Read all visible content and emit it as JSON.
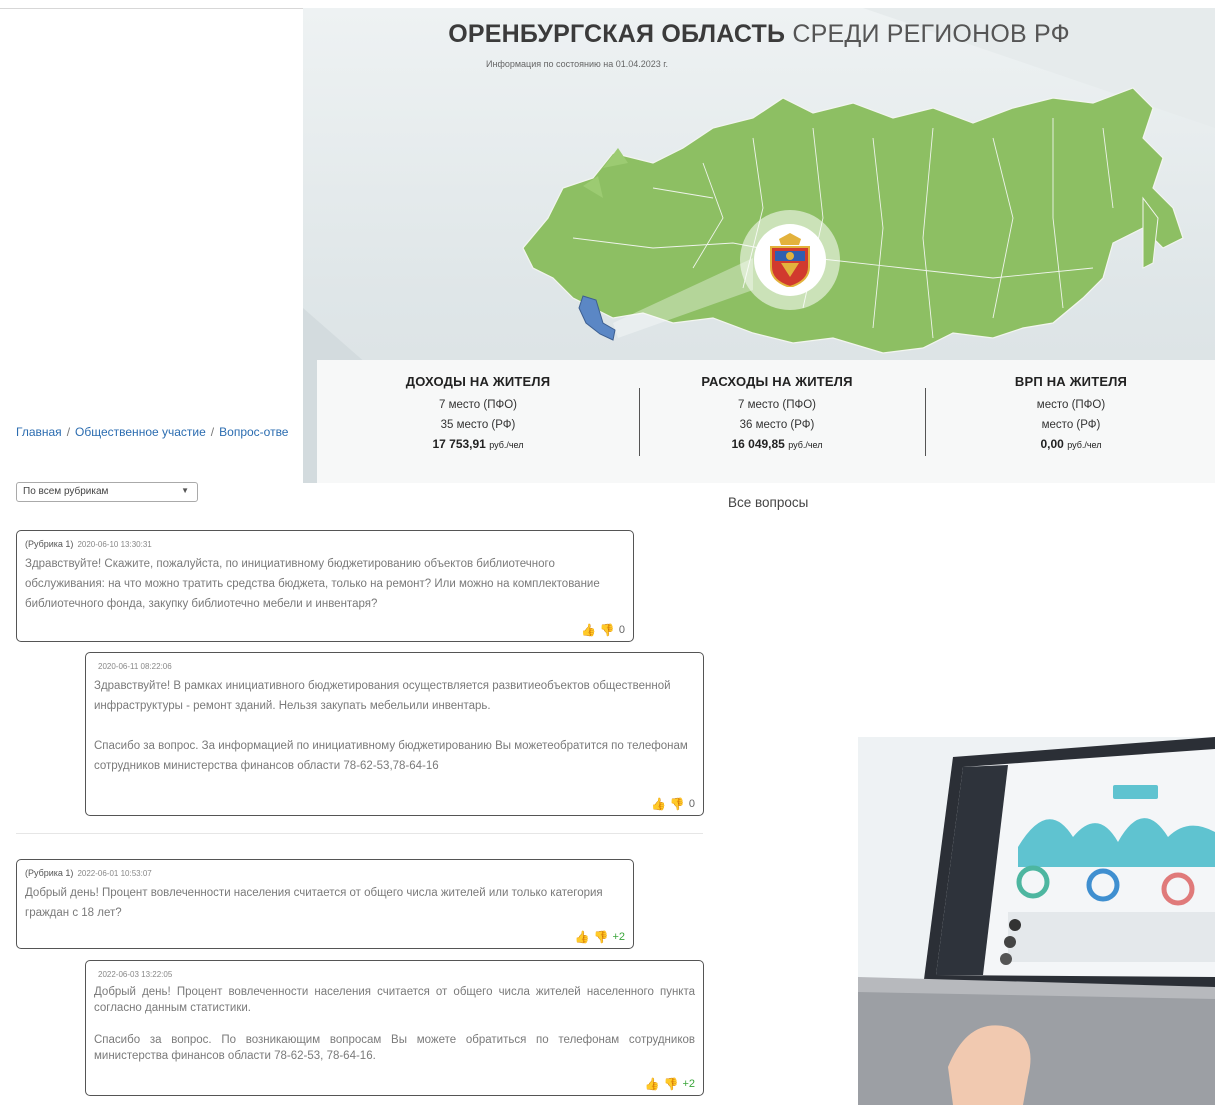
{
  "banner": {
    "title_bold": "ОРЕНБУРГСКАЯ ОБЛАСТЬ",
    "title_rest": "СРЕДИ РЕГИОНОВ РФ",
    "subtitle": "Информация по состоянию на 01.04.2023 г.",
    "stats": [
      {
        "heading": "ДОХОДЫ НА ЖИТЕЛЯ",
        "rank_pfo": "7 место (ПФО)",
        "rank_rf": "35 место (РФ)",
        "value": "17 753,91",
        "unit": "руб./чел"
      },
      {
        "heading": "РАСХОДЫ НА ЖИТЕЛЯ",
        "rank_pfo": "7 место (ПФО)",
        "rank_rf": "36 место (РФ)",
        "value": "16 049,85",
        "unit": "руб./чел"
      },
      {
        "heading": "ВРП НА ЖИТЕЛЯ",
        "rank_pfo": "место (ПФО)",
        "rank_rf": "место (РФ)",
        "value": "0,00",
        "unit": "руб./чел"
      }
    ]
  },
  "breadcrumb": {
    "home": "Главная",
    "section": "Общественное участие",
    "current": "Вопрос-отве",
    "separator": "/"
  },
  "filter": {
    "selected": "По всем рубрикам",
    "arrow": "▼"
  },
  "sidebar": {
    "all_questions": "Все вопросы"
  },
  "threads": [
    {
      "question": {
        "rubric": "(Рубрика 1)",
        "date": "2020-06-10 13:30:31",
        "text": "Здравствуйте! Скажите, пожалуйста, по инициативному бюджетированию объектов библиотечного обслуживания: на что можно тратить средства бюджета, только на ремонт? Или можно на комплектование библиотечного фонда, закупку библиотечно мебели и инвентаря?",
        "score": "0"
      },
      "answer": {
        "date": "2020-06-11 08:22:06",
        "text1": "Здравствуйте! В рамках инициативного бюджетирования осуществляется развитиеобъектов общественной инфраструктуры - ремонт зданий. Нельзя закупать мебельили инвентарь.",
        "text2": "Спасибо за вопрос. За информацией по инициативному бюджетированию Вы можетеобратится по телефонам сотрудников министерства финансов области 78-62-53,78-64-16",
        "score": "0"
      }
    },
    {
      "question": {
        "rubric": "(Рубрика 1)",
        "date": "2022-06-01 10:53:07",
        "text": "Добрый день! Процент вовлеченности населения считается от общего числа жителей или только категория граждан с 18 лет?",
        "score": "+2"
      },
      "answer": {
        "date": "2022-06-03 13:22:05",
        "text1": "Добрый день! Процент вовлеченности населения считается от общего числа жителей населенного пункта согласно данным статистики.",
        "text2": "Спасибо за вопрос. По возникающим вопросам Вы можете обратиться по телефонам сотрудников министерства финансов области 78-62-53, 78-64-16.",
        "score": "+2"
      }
    }
  ],
  "icons": {
    "thumb_up": "thumb-up-icon",
    "thumb_down": "thumb-down-icon"
  },
  "colors": {
    "map_green": "#8dbf63",
    "region_blue": "#5b87c5",
    "link_blue": "#2b6cb0",
    "score_green": "#3aa53a"
  }
}
